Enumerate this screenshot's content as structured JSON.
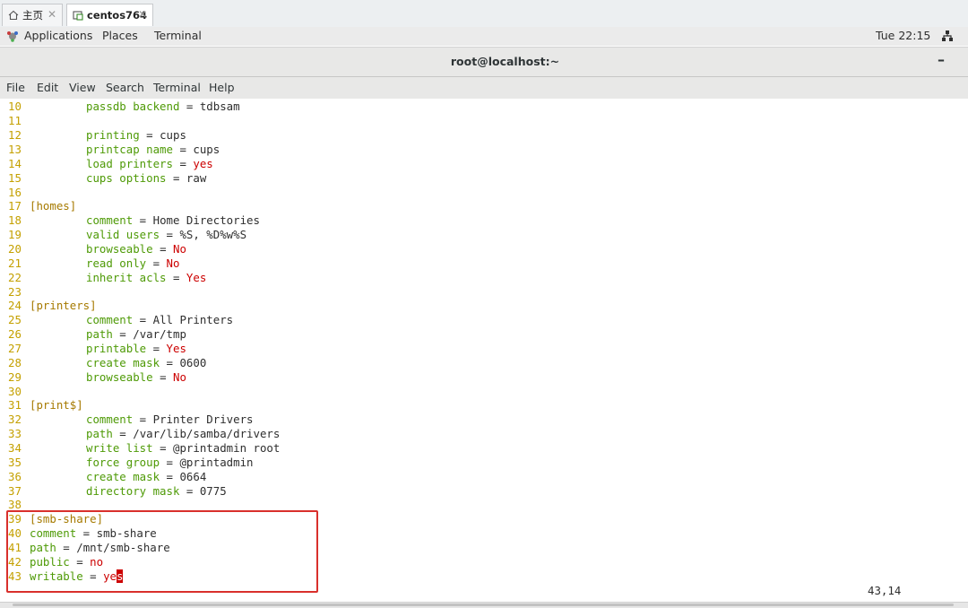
{
  "tabs": [
    {
      "label": "主页",
      "icon": "home-icon"
    },
    {
      "label": "centos764",
      "icon": "vm-icon"
    }
  ],
  "topbar": {
    "applications": "Applications",
    "places": "Places",
    "terminal": "Terminal",
    "clock": "Tue 22:15"
  },
  "window": {
    "title": "root@localhost:~",
    "minimize": "–"
  },
  "menu": {
    "file": "File",
    "edit": "Edit",
    "view": "View",
    "search": "Search",
    "terminal": "Terminal",
    "help": "Help"
  },
  "editor": {
    "lines": {
      "l10": {
        "n": "10",
        "k": "passdb backend",
        "op": " = ",
        "v": "tdbsam"
      },
      "l11": {
        "n": "11"
      },
      "l12": {
        "n": "12",
        "k": "printing",
        "op": " = ",
        "v": "cups"
      },
      "l13": {
        "n": "13",
        "k": "printcap name",
        "op": " = ",
        "v": "cups"
      },
      "l14": {
        "n": "14",
        "k": "load printers",
        "op": " = ",
        "v": "yes"
      },
      "l15": {
        "n": "15",
        "k": "cups options",
        "op": " = ",
        "v": "raw"
      },
      "l16": {
        "n": "16"
      },
      "l17": {
        "n": "17",
        "s": "[homes]"
      },
      "l18": {
        "n": "18",
        "k": "comment",
        "op": " = ",
        "v": "Home Directories"
      },
      "l19": {
        "n": "19",
        "k": "valid users",
        "op": " = ",
        "v": "%S, %D%w%S"
      },
      "l20": {
        "n": "20",
        "k": "browseable",
        "op": " = ",
        "v": "No"
      },
      "l21": {
        "n": "21",
        "k": "read only",
        "op": " = ",
        "v": "No"
      },
      "l22": {
        "n": "22",
        "k": "inherit acls",
        "op": " = ",
        "v": "Yes"
      },
      "l23": {
        "n": "23"
      },
      "l24": {
        "n": "24",
        "s": "[printers]"
      },
      "l25": {
        "n": "25",
        "k": "comment",
        "op": " = ",
        "v": "All Printers"
      },
      "l26": {
        "n": "26",
        "k": "path",
        "op": " = ",
        "v": "/var/tmp"
      },
      "l27": {
        "n": "27",
        "k": "printable",
        "op": " = ",
        "v": "Yes"
      },
      "l28": {
        "n": "28",
        "k": "create mask",
        "op": " = ",
        "v": "0600"
      },
      "l29": {
        "n": "29",
        "k": "browseable",
        "op": " = ",
        "v": "No"
      },
      "l30": {
        "n": "30"
      },
      "l31": {
        "n": "31",
        "s": "[print$]"
      },
      "l32": {
        "n": "32",
        "k": "comment",
        "op": " = ",
        "v": "Printer Drivers"
      },
      "l33": {
        "n": "33",
        "k": "path",
        "op": " = ",
        "v": "/var/lib/samba/drivers"
      },
      "l34": {
        "n": "34",
        "k": "write list",
        "op": " = ",
        "v": "@printadmin root"
      },
      "l35": {
        "n": "35",
        "k": "force group",
        "op": " = ",
        "v": "@printadmin"
      },
      "l36": {
        "n": "36",
        "k": "create mask",
        "op": " = ",
        "v": "0664"
      },
      "l37": {
        "n": "37",
        "k": "directory mask",
        "op": " = ",
        "v": "0775"
      },
      "l38": {
        "n": "38"
      },
      "l39": {
        "n": "39",
        "s": "[smb-share]"
      },
      "l40": {
        "n": "40",
        "k": "comment",
        "op": " = ",
        "v": "smb-share"
      },
      "l41": {
        "n": "41",
        "k": "path",
        "op": " = ",
        "v": "/mnt/smb-share"
      },
      "l42": {
        "n": "42",
        "k": "public",
        "op": " = ",
        "v": "no"
      },
      "l43": {
        "n": "43",
        "k": "writable",
        "op": " = ",
        "v": "ye",
        "cur": "s"
      }
    },
    "cursor_position": "43,14"
  },
  "colors": {
    "line_number": "#c4a000",
    "section": "#a67a00",
    "key": "#4e9a06",
    "boolean_value": "#cc0000",
    "highlight_box": "#d9302c"
  }
}
